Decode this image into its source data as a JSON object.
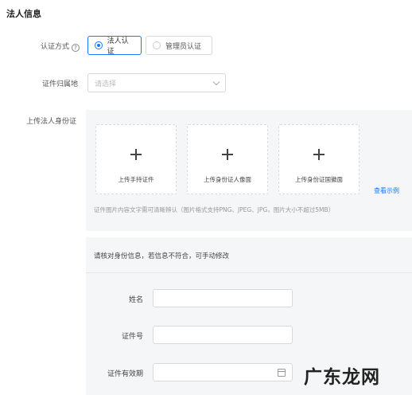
{
  "section": {
    "title": "法人信息"
  },
  "auth_method": {
    "label": "认证方式",
    "options": [
      {
        "label": "法人认证",
        "selected": true
      },
      {
        "label": "管理员认证",
        "selected": false
      }
    ]
  },
  "id_region": {
    "label": "证件归属地",
    "placeholder": "请选择"
  },
  "upload": {
    "label": "上传法人身份证",
    "cards": [
      "上传手持证件",
      "上传身份证人像面",
      "上传身份证国徽面"
    ],
    "example_link": "查看示例",
    "hint": "证件图片内容文字需可清晰辨认（图片格式支持PNG、JPEG、JPG，图片大小不超过5MB）"
  },
  "verify": {
    "note": "请核对身份信息，若信息不符合，可手动修改",
    "fields": {
      "name": "姓名",
      "id_number": "证件号",
      "validity": "证件有效期"
    }
  },
  "watermark": "广东龙网",
  "colors": {
    "accent": "#1677ff",
    "panel_bg": "#f5f6f7",
    "border": "#d9d9d9"
  }
}
